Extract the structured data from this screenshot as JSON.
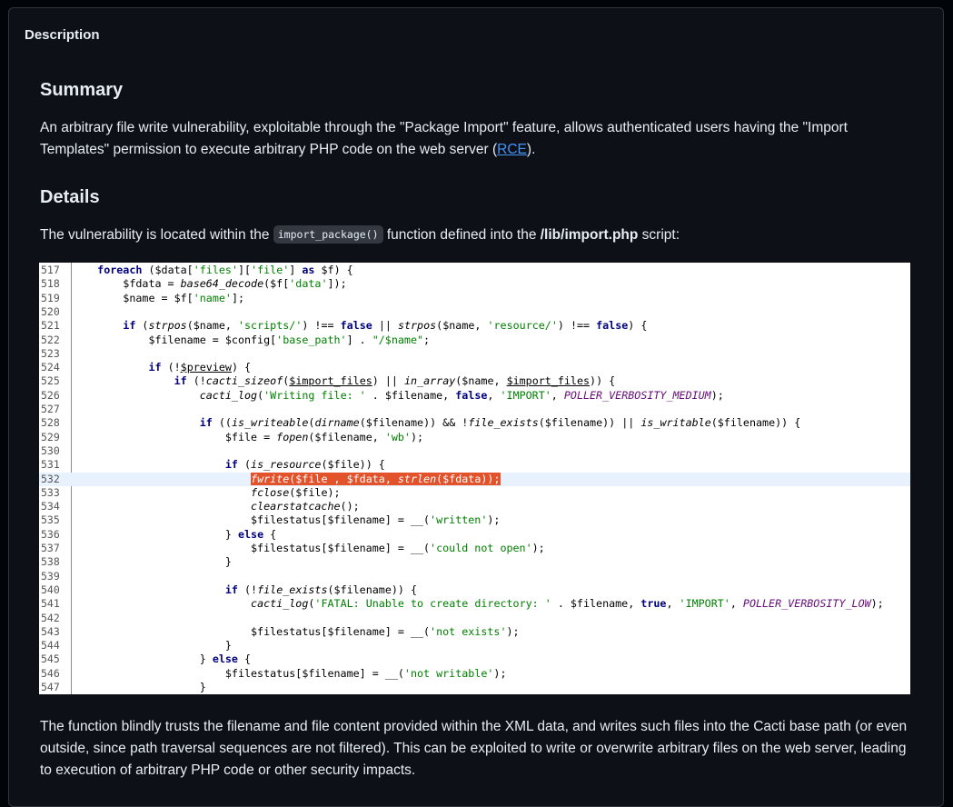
{
  "panel": {
    "header": "Description"
  },
  "summary": {
    "heading": "Summary",
    "text_before": "An arbitrary file write vulnerability, exploitable through the \"Package Import\" feature, allows authenticated users having the \"Import Templates\" permission to execute arbitrary PHP code on the web server (",
    "link": "RCE",
    "text_after": ")."
  },
  "details": {
    "heading": "Details",
    "intro_before": "The vulnerability is located within the ",
    "inline_code": "import_package()",
    "intro_middle": " function defined into the ",
    "path": "/lib/import.php",
    "intro_after": " script:",
    "explanation": "The function blindly trusts the filename and file content provided within the XML data, and writes such files into the Cacti base path (or even outside, since path traversal sequences are not filtered). This can be exploited to write or overwrite arbitrary files on the web server, leading to execution of arbitrary PHP code or other security impacts."
  },
  "code": {
    "highlighted_line": "532",
    "lines": [
      {
        "n": "517",
        "t": "    foreach ($data['files']['file'] as $f) {"
      },
      {
        "n": "518",
        "t": "        $fdata = base64_decode($f['data']);"
      },
      {
        "n": "519",
        "t": "        $name = $f['name'];"
      },
      {
        "n": "520",
        "t": ""
      },
      {
        "n": "521",
        "t": "        if (strpos($name, 'scripts/') !== false || strpos($name, 'resource/') !== false) {"
      },
      {
        "n": "522",
        "t": "            $filename = $config['base_path'] . \"/$name\";"
      },
      {
        "n": "523",
        "t": ""
      },
      {
        "n": "524",
        "t": "            if (!$preview) {"
      },
      {
        "n": "525",
        "t": "                if (!cacti_sizeof($import_files) || in_array($name, $import_files)) {"
      },
      {
        "n": "526",
        "t": "                    cacti_log('Writing file: ' . $filename, false, 'IMPORT', POLLER_VERBOSITY_MEDIUM);"
      },
      {
        "n": "527",
        "t": ""
      },
      {
        "n": "528",
        "t": "                    if ((is_writeable(dirname($filename)) && !file_exists($filename)) || is_writable($filename)) {"
      },
      {
        "n": "529",
        "t": "                        $file = fopen($filename, 'wb');"
      },
      {
        "n": "530",
        "t": ""
      },
      {
        "n": "531",
        "t": "                        if (is_resource($file)) {"
      },
      {
        "n": "532",
        "t": "                            fwrite($file , $fdata, strlen($fdata));"
      },
      {
        "n": "533",
        "t": "                            fclose($file);"
      },
      {
        "n": "534",
        "t": "                            clearstatcache();"
      },
      {
        "n": "535",
        "t": "                            $filestatus[$filename] = __('written');"
      },
      {
        "n": "536",
        "t": "                        } else {"
      },
      {
        "n": "537",
        "t": "                            $filestatus[$filename] = __('could not open');"
      },
      {
        "n": "538",
        "t": "                        }"
      },
      {
        "n": "539",
        "t": ""
      },
      {
        "n": "540",
        "t": "                        if (!file_exists($filename)) {"
      },
      {
        "n": "541",
        "t": "                            cacti_log('FATAL: Unable to create directory: ' . $filename, true, 'IMPORT', POLLER_VERBOSITY_LOW);"
      },
      {
        "n": "542",
        "t": ""
      },
      {
        "n": "543",
        "t": "                            $filestatus[$filename] = __('not exists');"
      },
      {
        "n": "544",
        "t": "                        }"
      },
      {
        "n": "545",
        "t": "                    } else {"
      },
      {
        "n": "546",
        "t": "                        $filestatus[$filename] = __('not writable');"
      },
      {
        "n": "547",
        "t": "                    }"
      }
    ]
  }
}
